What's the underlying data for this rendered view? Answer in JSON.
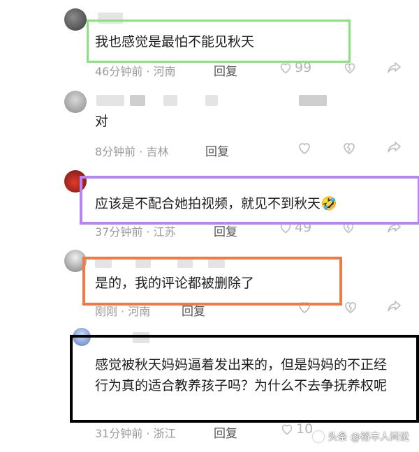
{
  "comments": [
    {
      "text": "我也感觉是最怕不能见秋天",
      "meta": "46分钟前 · 河南",
      "reply": "回复",
      "likes": "99"
    },
    {
      "text": "对",
      "meta": "8分钟前 · 吉林",
      "reply": "回复",
      "likes": ""
    },
    {
      "text": "应该是不配合她拍视频，就见不到秋天🤣",
      "meta": "37分钟前 · 江苏",
      "reply": "回复",
      "likes": "49"
    },
    {
      "text": "是的，我的评论都被删除了",
      "meta": "刚刚 · 河南",
      "reply": "回复",
      "likes": ""
    },
    {
      "text": "感觉被秋天妈妈逼着发出来的，但是妈妈的不正经行为真的适合教养孩子吗？为什么不去争抚养权呢",
      "meta": "31分钟前 · 浙江",
      "reply": "回复",
      "likes": "10"
    }
  ],
  "watermark": "头条 @裕丰人间说",
  "colors": {
    "green": "#86e47a",
    "purple": "#b884f4",
    "orange": "#f07a45",
    "black": "#000000"
  },
  "icons": [
    "heart-icon",
    "dislike-icon",
    "share-icon",
    "avatar"
  ]
}
